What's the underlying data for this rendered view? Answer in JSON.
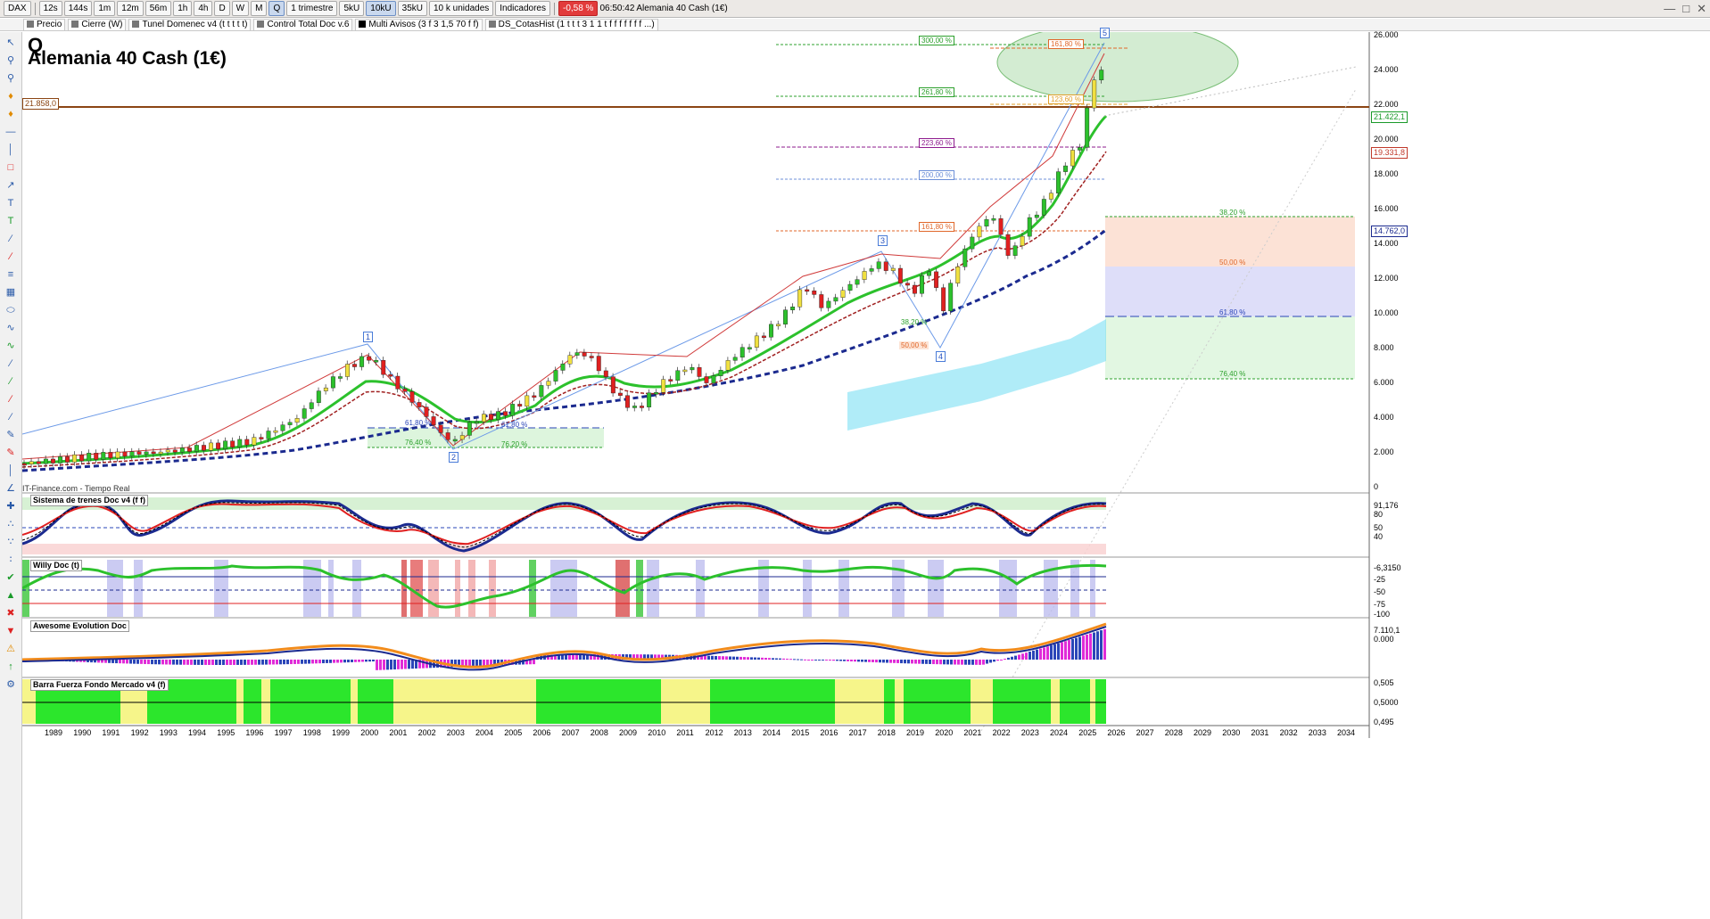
{
  "toolbar": {
    "symbol": "DAX",
    "timeframes": [
      "12s",
      "144s",
      "1m",
      "12m",
      "56m",
      "1h",
      "4h",
      "D",
      "W",
      "M",
      "Q"
    ],
    "period": "1 trimestre",
    "volumes": [
      "5kU",
      "10kU",
      "35kU"
    ],
    "units": "10 k unidades",
    "indicators": "Indicadores",
    "change": "-0,58 %",
    "time": "06:50:42",
    "instrument": "Alemania 40 Cash (1€)"
  },
  "toolbar2": [
    "Precio",
    "Cierre (W)",
    "Tunel Domenec v4 (t t t t t)",
    "Control Total Doc v.6",
    "Multi Avisos (3 f 3 1,5 70 f f)",
    "DS_CotasHist (1 t t t 3 1 1 t f f f f f f f ...)"
  ],
  "chart": {
    "q_label": "Q",
    "title": "Alemania 40 Cash (1€)",
    "source": "IT-Finance.com - Tiempo Real",
    "level_badge": "21.858,0",
    "price_axis": [
      "26.000",
      "24.000",
      "22.000",
      "20.000",
      "18.000",
      "16.000",
      "14.000",
      "12.000",
      "10.000",
      "8.000",
      "6.000",
      "4.000",
      "2.000",
      "0"
    ],
    "price_tags": [
      {
        "text": "21.422,1",
        "color": "#1a9a2a"
      },
      {
        "text": "19.331,8",
        "color": "#c0392b"
      },
      {
        "text": "14.762,0",
        "color": "#1b2a8f"
      }
    ],
    "fib_top": [
      {
        "text": "300,00 %",
        "color": "#2ca02c"
      },
      {
        "text": "261,80 %",
        "color": "#2ca02c"
      },
      {
        "text": "223,60 %",
        "color": "#8e1b8e"
      },
      {
        "text": "200,00 %",
        "color": "#6c8fd8"
      },
      {
        "text": "161,80 %",
        "color": "#e0672a"
      },
      {
        "text": "161,80 %",
        "color": "#e0672a"
      },
      {
        "text": "123,60 %",
        "color": "#e0a02a"
      }
    ],
    "fib_right": [
      {
        "text": "38,20 %",
        "color": "#2ca02c"
      },
      {
        "text": "50,00 %",
        "color": "#e0672a"
      },
      {
        "text": "61,80 %",
        "color": "#2a45b8"
      },
      {
        "text": "76,40 %",
        "color": "#2ca02c"
      }
    ],
    "fib_2003": [
      {
        "text": "61,80 %",
        "color": "#2a45b8"
      },
      {
        "text": "76,40 %",
        "color": "#2ca02c"
      },
      {
        "text": "61,80 %",
        "color": "#2a45b8"
      },
      {
        "text": "76,20 %",
        "color": "#2ca02c"
      }
    ],
    "fib_2020": [
      {
        "text": "38,20 %",
        "color": "#2ca02c"
      },
      {
        "text": "50,00 %",
        "color": "#e0672a"
      }
    ],
    "waves": [
      "1",
      "2",
      "3",
      "4",
      "5"
    ],
    "years": [
      "1989",
      "1990",
      "1991",
      "1992",
      "1993",
      "1994",
      "1995",
      "1996",
      "1997",
      "1998",
      "1999",
      "2000",
      "2001",
      "2002",
      "2003",
      "2004",
      "2005",
      "2006",
      "2007",
      "2008",
      "2009",
      "2010",
      "2011",
      "2012",
      "2013",
      "2014",
      "2015",
      "2016",
      "2017",
      "2018",
      "2019",
      "2020",
      "2021",
      "2022",
      "2023",
      "2024",
      "2025",
      "2026",
      "2027",
      "2028",
      "2029",
      "2030",
      "2031",
      "2032",
      "2033",
      "2034"
    ]
  },
  "panels": {
    "trenes": {
      "title": "Sistema de trenes Doc v4 (f f)",
      "axis": [
        "91,176",
        "80",
        "50",
        "40"
      ]
    },
    "willy": {
      "title": "Willy Doc (t)",
      "axis": [
        "-6,3150",
        "-25",
        "-50",
        "-75",
        "-100"
      ]
    },
    "awesome": {
      "title": "Awesome Evolution Doc",
      "axis": [
        "7.110,1",
        "0.000"
      ]
    },
    "barra": {
      "title": "Barra Fuerza Fondo Mercado v4 (f)",
      "axis": [
        "0,505",
        "0,5000",
        "0,495"
      ]
    }
  }
}
